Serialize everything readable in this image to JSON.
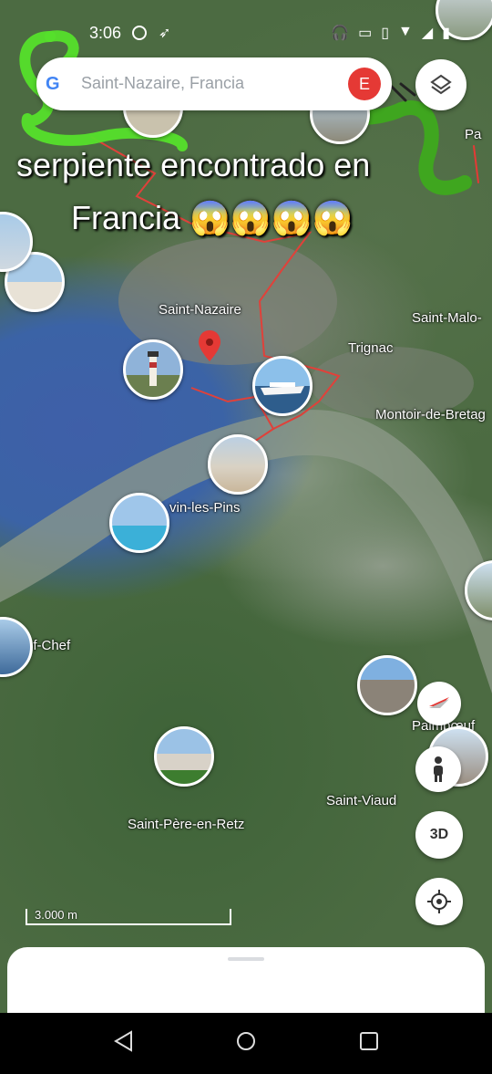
{
  "status_bar": {
    "time": "3:06"
  },
  "search": {
    "placeholder": "Saint-Nazaire, Francia",
    "avatar_letter": "E"
  },
  "caption": {
    "line1": "serpiente encontrado en",
    "line2": "Francia 😱😱😱😱"
  },
  "map": {
    "labels": {
      "saint_nazaire": "Saint-Nazaire",
      "trignac": "Trignac",
      "saint_malo": "Saint-Malo-",
      "montoir": "Montoir-de-Bretag",
      "pornichet": "vin-les-Pins",
      "chef_chef": "ef-Chef",
      "saint_pere": "Saint-Père-en-Retz",
      "saint_viaud": "Saint-Viaud",
      "paimboeuf": "Paimbœuf",
      "top_right": "Pa"
    },
    "scale_label": "3.000 m"
  },
  "controls": {
    "three_d_label": "3D"
  },
  "colors": {
    "accent_red": "#e53935",
    "snake_green": "#55e02b",
    "water_blue": "#3b63a6"
  }
}
